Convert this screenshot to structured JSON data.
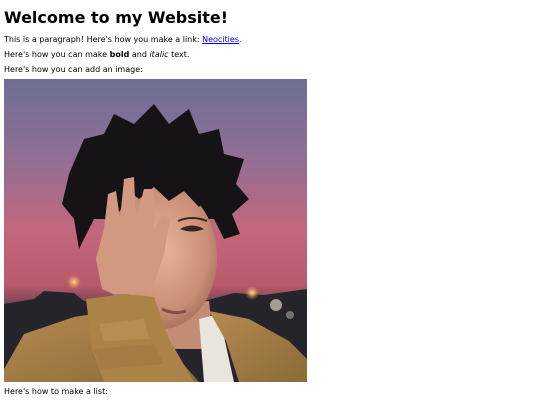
{
  "heading": "Welcome to my Website!",
  "para1": {
    "before": "This is a paragraph! Here's how you make a link: ",
    "link_text": "Neocities",
    "after": "."
  },
  "para2": {
    "before": "Here's how you can make ",
    "bold": "bold",
    "middle": " and ",
    "italic": "italic",
    "after": " text."
  },
  "para3": "Here's how you can add an image:",
  "image": {
    "alt": "photo of a young man with spiky black hair covering one eye with his hand against a pink sunset sky"
  },
  "para4": "Here's how to make a list:",
  "colors": {
    "link": "#0000ee"
  }
}
